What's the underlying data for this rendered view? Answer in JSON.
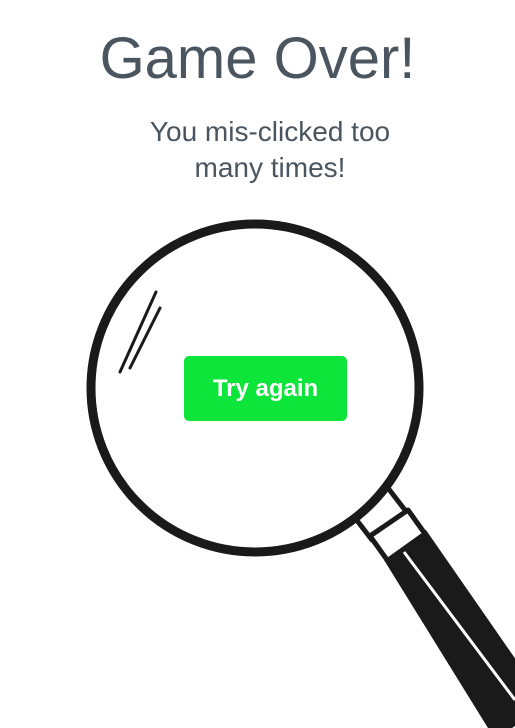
{
  "screen": {
    "title": "Game Over!",
    "message": "You mis-clicked too many times!",
    "retry_label": "Try again"
  },
  "colors": {
    "text": "#4a5560",
    "button": "#0de53a",
    "button_text": "#ffffff",
    "magnifier": "#1a1a1a"
  },
  "icons": {
    "magnifier": "magnifying-glass-icon"
  }
}
